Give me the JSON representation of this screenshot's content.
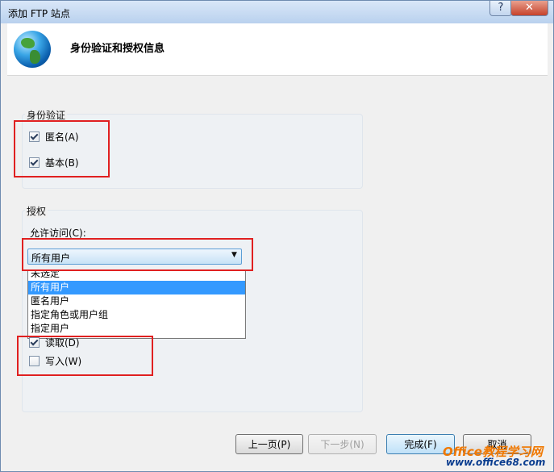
{
  "window": {
    "title": "添加 FTP 站点",
    "help_label": "?",
    "close_label": "✕"
  },
  "header": {
    "title": "身份验证和授权信息",
    "icon": "globe-icon"
  },
  "auth": {
    "label": "身份验证",
    "anonymous": {
      "label": "匿名(A)",
      "checked": true
    },
    "basic": {
      "label": "基本(B)",
      "checked": true
    }
  },
  "authorization": {
    "label": "授权",
    "allow_access_label": "允许访问(C):",
    "selected": "所有用户",
    "options": [
      "未选定",
      "所有用户",
      "匿名用户",
      "指定角色或用户组",
      "指定用户"
    ],
    "selected_index": 1
  },
  "permissions": {
    "read": {
      "label": "读取(D)",
      "checked": true
    },
    "write": {
      "label": "写入(W)",
      "checked": false
    }
  },
  "buttons": {
    "prev": "上一页(P)",
    "next": "下一步(N)",
    "finish": "完成(F)",
    "cancel": "取消"
  },
  "watermark": {
    "line1": "Office教程学习网",
    "line2": "www.office68.com"
  },
  "colors": {
    "highlight": "#e02020",
    "selection": "#3399ff",
    "watermark_orange": "#f07800",
    "watermark_blue": "#0a3d8f"
  }
}
